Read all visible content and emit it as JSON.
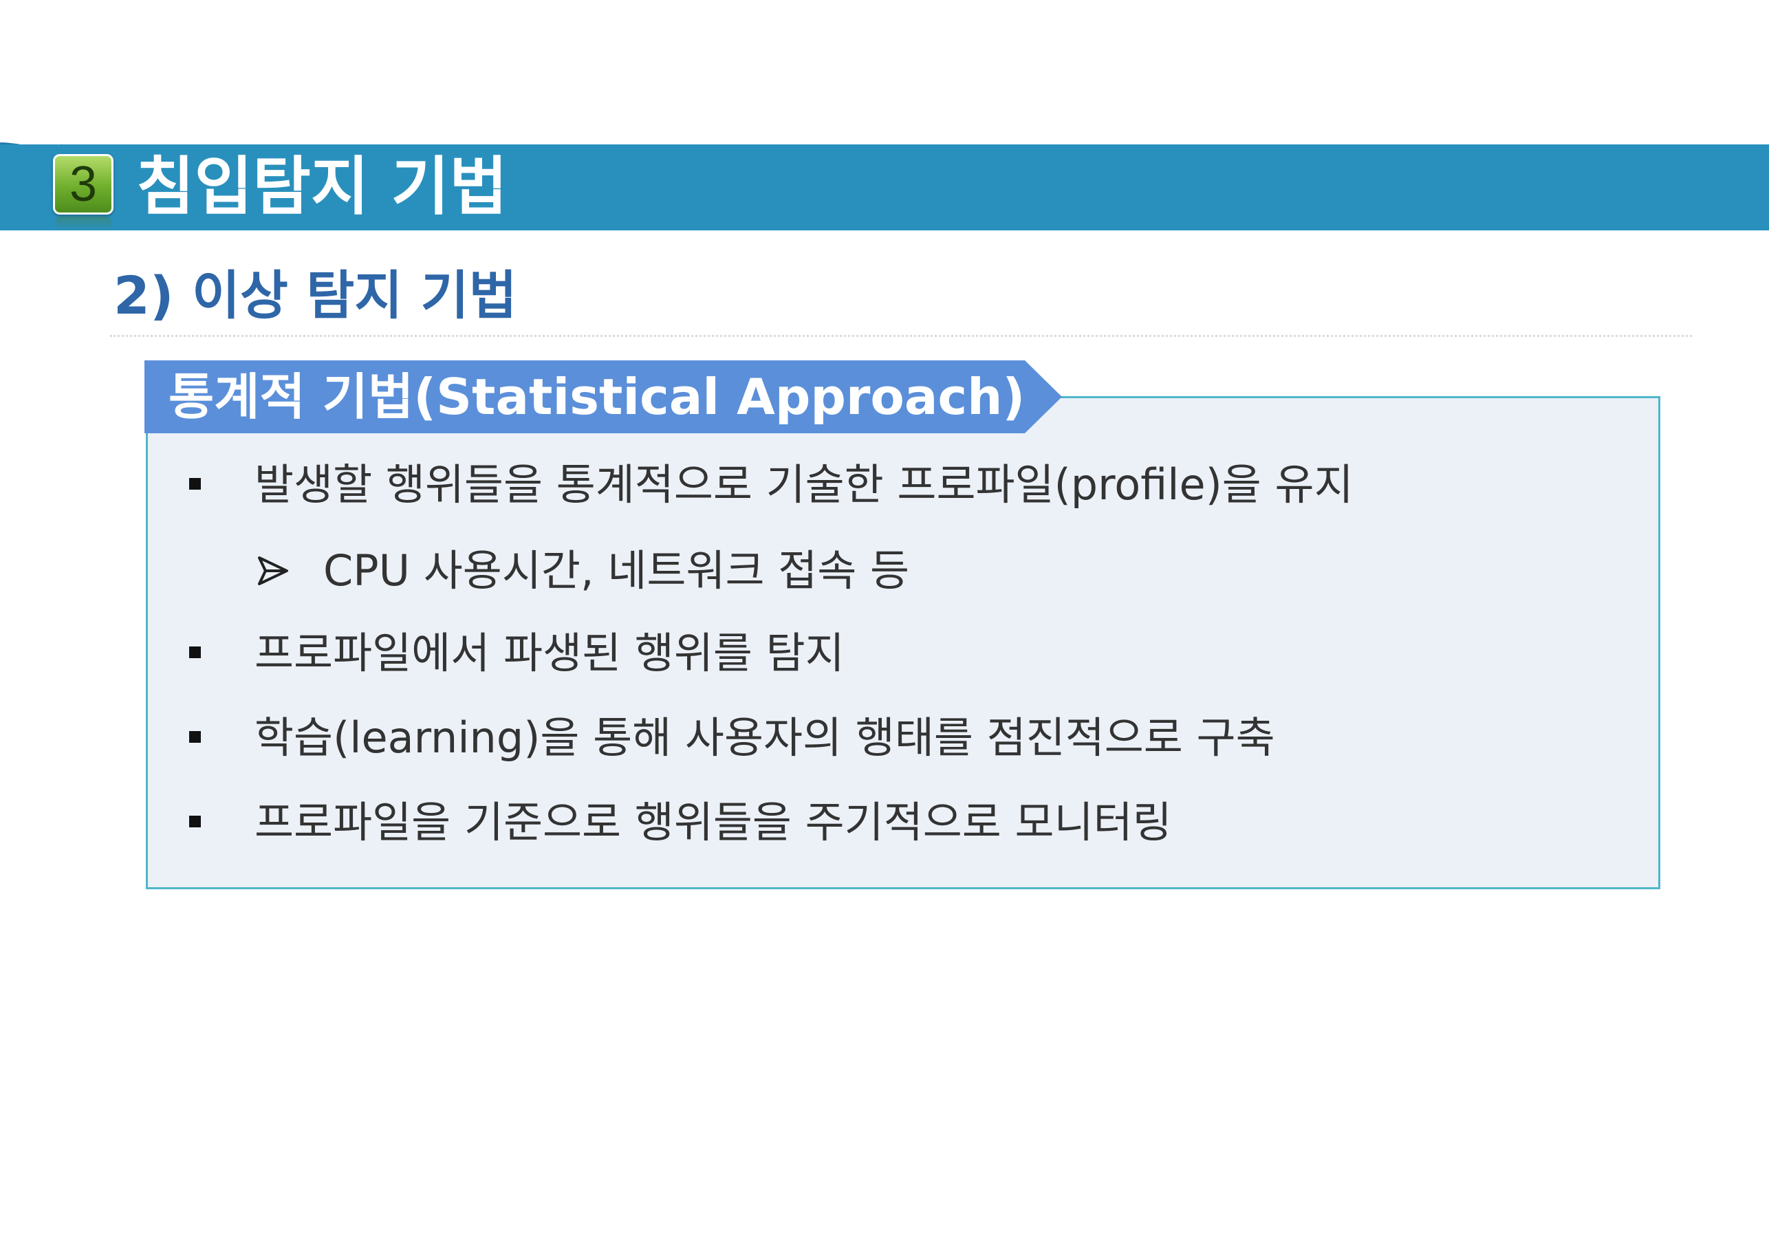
{
  "section": {
    "number": "3",
    "title": "침입탐지 기법"
  },
  "subheading": "2) 이상 탐지 기법",
  "box": {
    "tab_label": "통계적 기법(Statistical Approach)",
    "items": [
      {
        "level": 1,
        "text": "발생할 행위들을 통계적으로 기술한 프로파일(profile)을 유지"
      },
      {
        "level": 2,
        "text": "CPU 사용시간, 네트워크 접속 등"
      },
      {
        "level": 1,
        "text": "프로파일에서 파생된 행위를 탐지"
      },
      {
        "level": 1,
        "text": "학습(learning)을 통해 사용자의 행태를 점진적으로 구축"
      },
      {
        "level": 1,
        "text": "프로파일을 기준으로 행위들을 주기적으로 모니터링"
      }
    ]
  },
  "colors": {
    "band": "#2990bd",
    "subheading": "#2e66a8",
    "tab": "#5b8fd9",
    "box_bg": "#ecf1f8",
    "box_border": "#4fb6c8"
  }
}
